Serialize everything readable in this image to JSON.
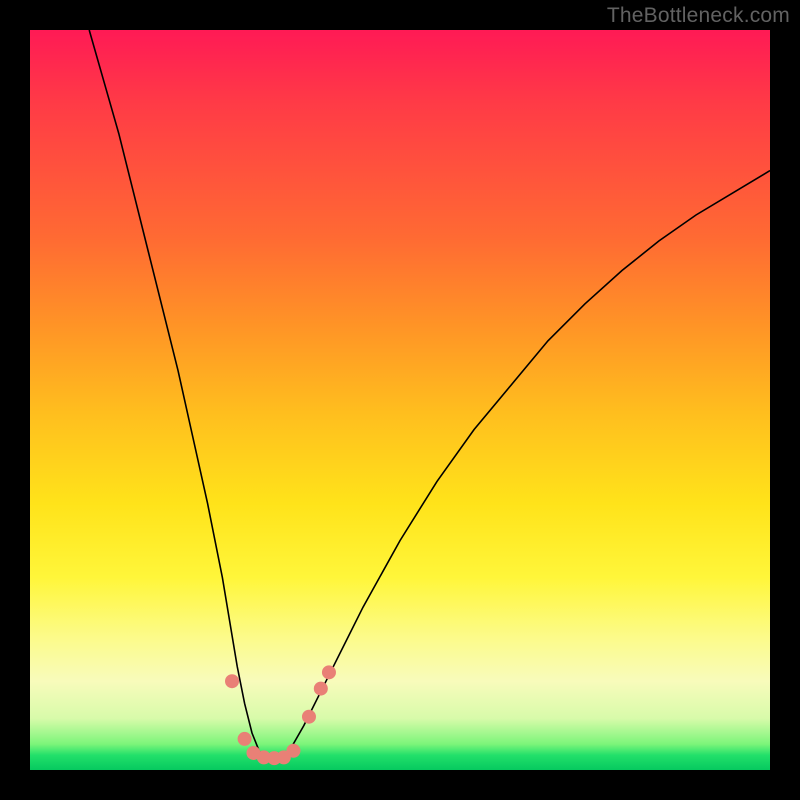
{
  "watermark": "TheBottleneck.com",
  "chart_data": {
    "type": "line",
    "title": "",
    "xlabel": "",
    "ylabel": "",
    "xlim": [
      0,
      100
    ],
    "ylim": [
      0,
      100
    ],
    "grid": false,
    "legend": false,
    "annotations": [],
    "series": [
      {
        "name": "curve",
        "x": [
          8,
          10,
          12,
          14,
          16,
          18,
          20,
          22,
          24,
          26,
          27,
          28,
          29,
          30,
          31,
          32,
          33,
          34,
          35,
          37,
          40,
          45,
          50,
          55,
          60,
          65,
          70,
          75,
          80,
          85,
          90,
          95,
          100
        ],
        "y": [
          100,
          93,
          86,
          78,
          70,
          62,
          54,
          45,
          36,
          26,
          20,
          14,
          9,
          5,
          2.5,
          1.6,
          1.4,
          1.6,
          2.5,
          6,
          12,
          22,
          31,
          39,
          46,
          52,
          58,
          63,
          67.5,
          71.5,
          75,
          78,
          81
        ],
        "stroke": "#000000",
        "width": 1.6
      }
    ],
    "markers": [
      {
        "x": 27.3,
        "y": 12.0,
        "r": 7,
        "fill": "#e98076"
      },
      {
        "x": 29.0,
        "y": 4.2,
        "r": 7,
        "fill": "#e98076"
      },
      {
        "x": 30.2,
        "y": 2.3,
        "r": 7,
        "fill": "#e98076"
      },
      {
        "x": 31.6,
        "y": 1.7,
        "r": 7,
        "fill": "#e98076"
      },
      {
        "x": 33.0,
        "y": 1.6,
        "r": 7,
        "fill": "#e98076"
      },
      {
        "x": 34.3,
        "y": 1.7,
        "r": 7,
        "fill": "#e98076"
      },
      {
        "x": 35.6,
        "y": 2.6,
        "r": 7,
        "fill": "#e98076"
      },
      {
        "x": 37.7,
        "y": 7.2,
        "r": 7,
        "fill": "#e98076"
      },
      {
        "x": 39.3,
        "y": 11.0,
        "r": 7,
        "fill": "#e98076"
      },
      {
        "x": 40.4,
        "y": 13.2,
        "r": 7,
        "fill": "#e98076"
      }
    ]
  }
}
